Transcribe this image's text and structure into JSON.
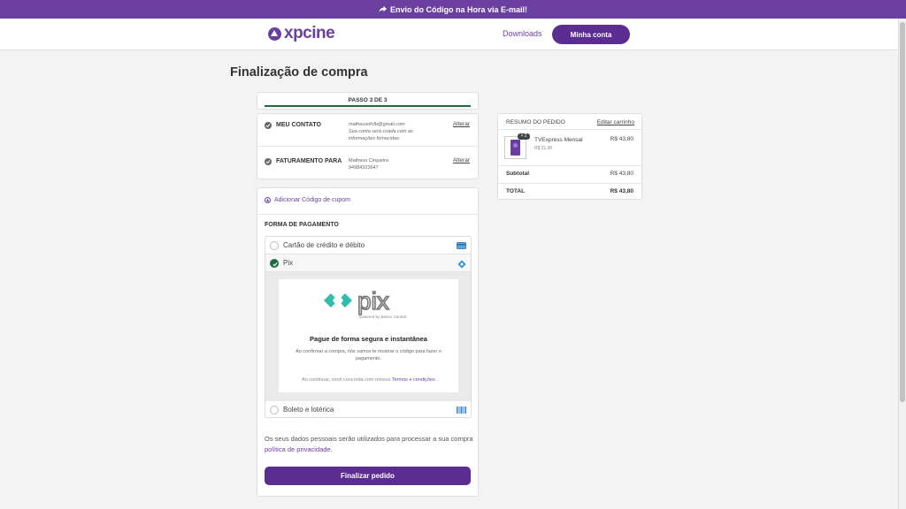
{
  "promo": {
    "text": "Envio do Código na Hora via E-mail!"
  },
  "header": {
    "logo": "xpcine",
    "nav_downloads": "Downloads",
    "account_button": "Minha conta"
  },
  "page": {
    "title": "Finalização de compra"
  },
  "steps": {
    "label": "PASSO 3 DE 3"
  },
  "contact": {
    "label": "MEU CONTATO",
    "email": "matheusofcfb@gmail.com",
    "note_line1": "Sua conta será criada com as",
    "note_line2": "informações fornecidas.",
    "edit": "Alterar"
  },
  "billing": {
    "label": "FATURAMENTO PARA",
    "name": "Matheus Cirqueira",
    "phone": "94984323647",
    "edit": "Alterar"
  },
  "coupon": {
    "label": "Adicionar Código de cupom"
  },
  "payment": {
    "title": "FORMA DE PAGAMENTO",
    "methods": [
      {
        "label": "Cartão de crédito e débito",
        "selected": false,
        "icon": "credit-card-icon"
      },
      {
        "label": "Pix",
        "selected": true,
        "icon": "pix-icon"
      },
      {
        "label": "Boleto e lotérica",
        "selected": false,
        "icon": "barcode-icon"
      }
    ],
    "pix": {
      "logo_text": "pix",
      "logo_tagline": "powered by Banco Central",
      "headline": "Pague de forma segura e instantânea",
      "description": "Ao confirmar a compra, nós vamos te mostrar o código para fazer o pagamento.",
      "terms_prefix": "Ao continuar, você concorda com nossos",
      "terms_link": "Termos e condições"
    }
  },
  "privacy": {
    "text": "Os seus dados pessoais serão utilizados para processar a sua compra",
    "link": "política de privacidade",
    "suffix": "."
  },
  "finalize_button": "Finalizar pedido",
  "summary": {
    "title": "RESUMO DO PEDIDO",
    "edit_cart": "Editar carrinho",
    "item": {
      "quantity": "× 2",
      "name": "TVExpress Mensal",
      "unit_price": "R$ 21,90",
      "price": "R$ 43,80"
    },
    "subtotal_label": "Subtotal",
    "subtotal_value": "R$ 43,80",
    "total_label": "TOTAL",
    "total_value": "R$ 43,80"
  },
  "colors": {
    "brand": "#6a3fa0",
    "button": "#5c2d91",
    "success": "#1e6b3c",
    "pix_teal": "#32bcad"
  }
}
